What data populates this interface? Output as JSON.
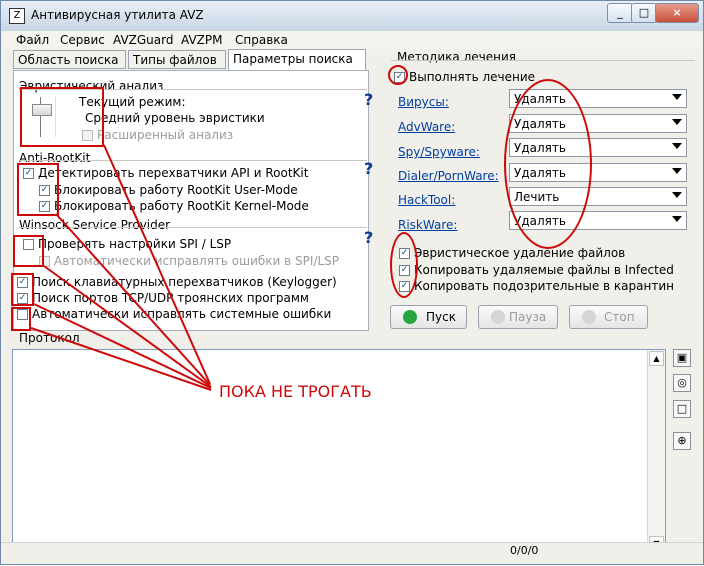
{
  "window": {
    "title": "Антивирусная утилита AVZ",
    "buttons": [
      "_",
      "□",
      "×"
    ]
  },
  "menu": [
    "Файл",
    "Сервис",
    "AVZGuard",
    "AVZPM",
    "Справка"
  ],
  "tabs": [
    "Область поиска",
    "Типы файлов",
    "Параметры поиска"
  ],
  "search_options": {
    "heuristic_label": "Эвристический анализ",
    "mode_label": "Текущий режим:",
    "mode_value": "Средний уровень эвристики",
    "extended_analysis": "Расширенный анализ",
    "antirootkit_label": "Anti-RootKit",
    "detect_api": "Детектировать перехватчики API и RootKit",
    "block_user": "Блокировать работу RootKit User-Mode",
    "block_kernel": "Блокировать работу RootKit Kernel-Mode",
    "winsock_label": "Winsock Service Provider",
    "check_spi": "Проверять настройки SPI / LSP",
    "auto_fix_spi": "Автоматически исправлять ошибки в SPI/LSP",
    "keylogger": "Поиск клавиатурных перехватчиков (Keylogger)",
    "trojan_ports": "Поиск портов TCP/UDP троянских программ",
    "auto_fix_system": "Автоматически исправлять системные ошибки"
  },
  "treatment": {
    "title": "Методика лечения",
    "perform": "Выполнять лечение",
    "items": [
      {
        "name": "Вирусы:",
        "value": "Удалять"
      },
      {
        "name": "AdvWare:",
        "value": "Удалять"
      },
      {
        "name": "Spy/Spyware:",
        "value": "Удалять"
      },
      {
        "name": "Dialer/PornWare:",
        "value": "Удалять"
      },
      {
        "name": "HackTool:",
        "value": "Лечить"
      },
      {
        "name": "RiskWare:",
        "value": "Удалять"
      }
    ],
    "heuristic_delete": "Эвристическое удаление файлов",
    "copy_infected": "Копировать удаляемые файлы в Infected",
    "copy_quarantine": "Копировать подозрительные в карантин"
  },
  "controls": {
    "start": "Пуск",
    "pause": "Пауза",
    "stop": "Стоп"
  },
  "protocol": {
    "label": "Протокол",
    "content": ""
  },
  "status": {
    "counter": "0/0/0"
  },
  "annotation": {
    "text": "ПОКА НЕ ТРОГАТЬ",
    "color": "#cc0a0a"
  },
  "help_mark": "?"
}
